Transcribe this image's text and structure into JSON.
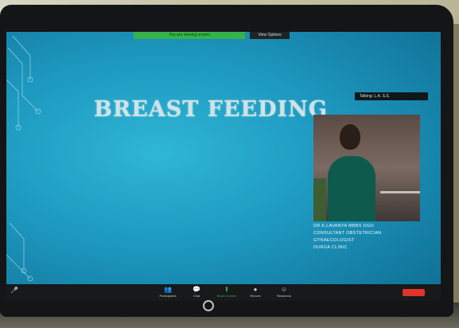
{
  "zoom": {
    "share_bar": "You are viewing screen",
    "view_options": "View Options",
    "speaker_label": "Talking: L.A. S.S.",
    "toolbar": [
      {
        "icon": "participants-icon",
        "glyph": "👥",
        "label": "Participants"
      },
      {
        "icon": "chat-icon",
        "glyph": "💬",
        "label": "Chat"
      },
      {
        "icon": "share-screen-icon",
        "glyph": "⬆",
        "label": "Share Screen"
      },
      {
        "icon": "record-icon",
        "glyph": "●",
        "label": "Record"
      },
      {
        "icon": "reactions-icon",
        "glyph": "☺",
        "label": "Reactions"
      }
    ]
  },
  "slide": {
    "title": "BREAST FEEDING"
  },
  "speaker": {
    "name": "DR.K.LAVANYA MBBS DGO",
    "line2": "CONSULTANT OBSTETRICIAN",
    "line3": "GYNAECOLOGIST",
    "line4": "DURGA CLINIC"
  },
  "colors": {
    "slide_bg": "#1d98bf",
    "zoom_green": "#35b34a",
    "end_red": "#e0342b"
  }
}
